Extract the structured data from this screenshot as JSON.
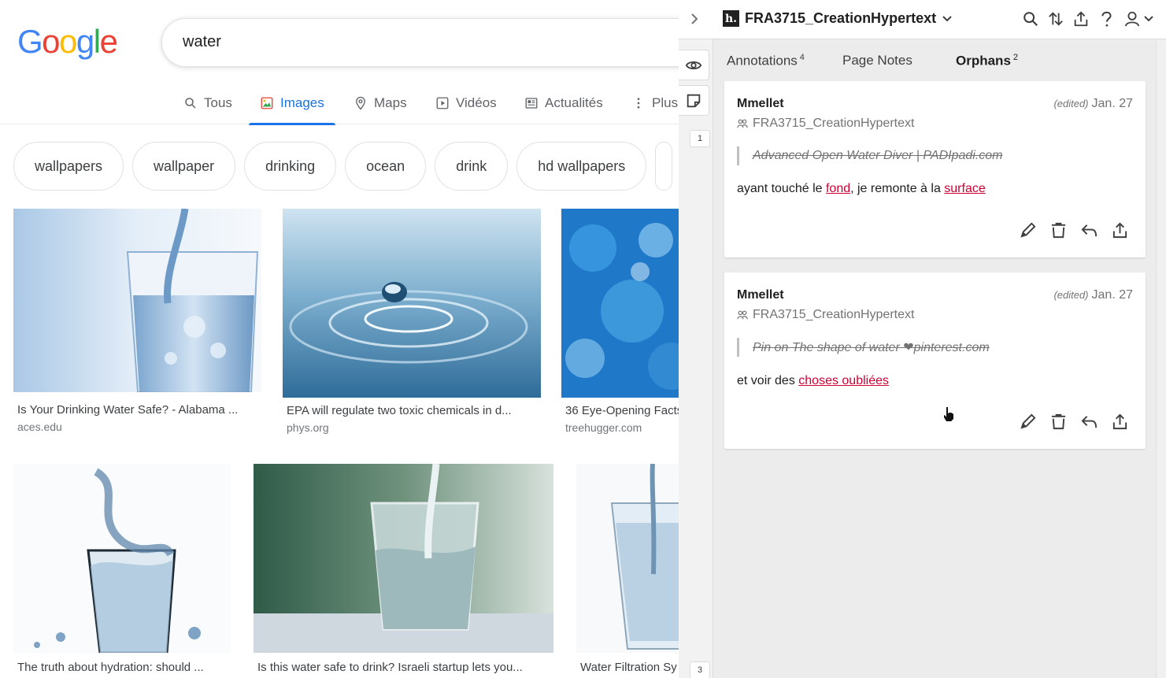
{
  "google": {
    "logo": [
      "G",
      "o",
      "o",
      "g",
      "l",
      "e"
    ],
    "search_value": "water",
    "tabs": [
      {
        "label": "Tous",
        "icon": "search-icon"
      },
      {
        "label": "Images",
        "icon": "image-icon"
      },
      {
        "label": "Maps",
        "icon": "map-pin-icon"
      },
      {
        "label": "Vidéos",
        "icon": "video-icon"
      },
      {
        "label": "Actualités",
        "icon": "newspaper-icon"
      },
      {
        "label": "Plus",
        "icon": "more-vertical-icon"
      }
    ],
    "active_tab": "Images",
    "chips": [
      "wallpapers",
      "wallpaper",
      "drinking",
      "ocean",
      "drink",
      "hd wallpapers"
    ],
    "results_row1": [
      {
        "title": "Is Your Drinking Water Safe? - Alabama ...",
        "site": "aces.edu"
      },
      {
        "title": "EPA will regulate two toxic chemicals in d...",
        "site": "phys.org"
      },
      {
        "title": "36 Eye-Opening Facts",
        "site": "treehugger.com"
      }
    ],
    "results_row2": [
      {
        "title": "The truth about hydration: should ..."
      },
      {
        "title": "Is this water safe to drink? Israeli startup lets you..."
      },
      {
        "title": "Water Filtration Sy"
      }
    ]
  },
  "hypothesis": {
    "group_name": "FRA3715_CreationHypertext",
    "bucket_counts": [
      "1",
      "3"
    ],
    "tabs": {
      "annotations": {
        "label": "Annotations",
        "count": "4"
      },
      "page_notes": {
        "label": "Page Notes"
      },
      "orphans": {
        "label": "Orphans",
        "count": "2"
      }
    },
    "cards": [
      {
        "user": "Mmellet",
        "edited": "(edited)",
        "date": "Jan. 27",
        "group": "FRA3715_CreationHypertext",
        "quote": "Advanced Open Water Diver | PADIpadi.com",
        "body_prefix": "ayant touché le ",
        "link1": "fond",
        "body_middle": ", je remonte à la ",
        "link2": "surface"
      },
      {
        "user": "Mmellet",
        "edited": "(edited)",
        "date": "Jan. 27",
        "group": "FRA3715_CreationHypertext",
        "quote": "Pin on The shape of water ❤pinterest.com",
        "body_prefix": "et voir des ",
        "link1": "choses oubliées"
      }
    ]
  },
  "colors": {
    "google_blue": "#1a73e8",
    "annotation_link": "#d00032",
    "sidebar_bg": "#ececec"
  }
}
